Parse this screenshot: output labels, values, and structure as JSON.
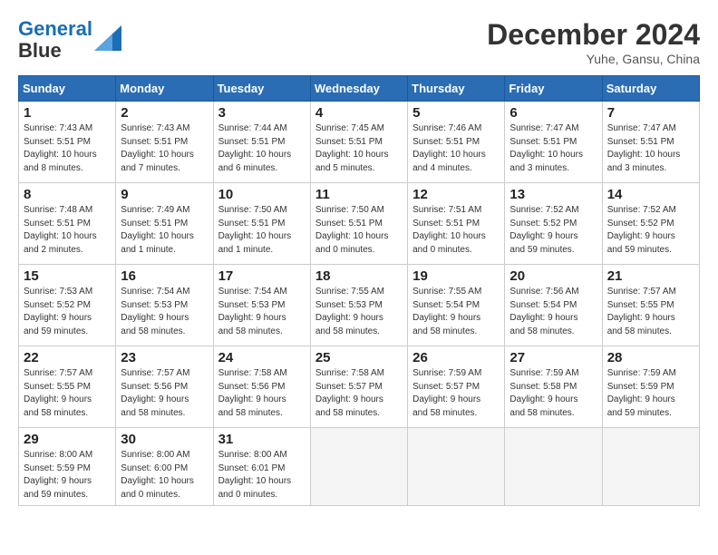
{
  "header": {
    "logo_line1": "General",
    "logo_line2": "Blue",
    "month": "December 2024",
    "location": "Yuhe, Gansu, China"
  },
  "days_of_week": [
    "Sunday",
    "Monday",
    "Tuesday",
    "Wednesday",
    "Thursday",
    "Friday",
    "Saturday"
  ],
  "weeks": [
    [
      {
        "day": 1,
        "info": "Sunrise: 7:43 AM\nSunset: 5:51 PM\nDaylight: 10 hours\nand 8 minutes."
      },
      {
        "day": 2,
        "info": "Sunrise: 7:43 AM\nSunset: 5:51 PM\nDaylight: 10 hours\nand 7 minutes."
      },
      {
        "day": 3,
        "info": "Sunrise: 7:44 AM\nSunset: 5:51 PM\nDaylight: 10 hours\nand 6 minutes."
      },
      {
        "day": 4,
        "info": "Sunrise: 7:45 AM\nSunset: 5:51 PM\nDaylight: 10 hours\nand 5 minutes."
      },
      {
        "day": 5,
        "info": "Sunrise: 7:46 AM\nSunset: 5:51 PM\nDaylight: 10 hours\nand 4 minutes."
      },
      {
        "day": 6,
        "info": "Sunrise: 7:47 AM\nSunset: 5:51 PM\nDaylight: 10 hours\nand 3 minutes."
      },
      {
        "day": 7,
        "info": "Sunrise: 7:47 AM\nSunset: 5:51 PM\nDaylight: 10 hours\nand 3 minutes."
      }
    ],
    [
      {
        "day": 8,
        "info": "Sunrise: 7:48 AM\nSunset: 5:51 PM\nDaylight: 10 hours\nand 2 minutes."
      },
      {
        "day": 9,
        "info": "Sunrise: 7:49 AM\nSunset: 5:51 PM\nDaylight: 10 hours\nand 1 minute."
      },
      {
        "day": 10,
        "info": "Sunrise: 7:50 AM\nSunset: 5:51 PM\nDaylight: 10 hours\nand 1 minute."
      },
      {
        "day": 11,
        "info": "Sunrise: 7:50 AM\nSunset: 5:51 PM\nDaylight: 10 hours\nand 0 minutes."
      },
      {
        "day": 12,
        "info": "Sunrise: 7:51 AM\nSunset: 5:51 PM\nDaylight: 10 hours\nand 0 minutes."
      },
      {
        "day": 13,
        "info": "Sunrise: 7:52 AM\nSunset: 5:52 PM\nDaylight: 9 hours\nand 59 minutes."
      },
      {
        "day": 14,
        "info": "Sunrise: 7:52 AM\nSunset: 5:52 PM\nDaylight: 9 hours\nand 59 minutes."
      }
    ],
    [
      {
        "day": 15,
        "info": "Sunrise: 7:53 AM\nSunset: 5:52 PM\nDaylight: 9 hours\nand 59 minutes."
      },
      {
        "day": 16,
        "info": "Sunrise: 7:54 AM\nSunset: 5:53 PM\nDaylight: 9 hours\nand 58 minutes."
      },
      {
        "day": 17,
        "info": "Sunrise: 7:54 AM\nSunset: 5:53 PM\nDaylight: 9 hours\nand 58 minutes."
      },
      {
        "day": 18,
        "info": "Sunrise: 7:55 AM\nSunset: 5:53 PM\nDaylight: 9 hours\nand 58 minutes."
      },
      {
        "day": 19,
        "info": "Sunrise: 7:55 AM\nSunset: 5:54 PM\nDaylight: 9 hours\nand 58 minutes."
      },
      {
        "day": 20,
        "info": "Sunrise: 7:56 AM\nSunset: 5:54 PM\nDaylight: 9 hours\nand 58 minutes."
      },
      {
        "day": 21,
        "info": "Sunrise: 7:57 AM\nSunset: 5:55 PM\nDaylight: 9 hours\nand 58 minutes."
      }
    ],
    [
      {
        "day": 22,
        "info": "Sunrise: 7:57 AM\nSunset: 5:55 PM\nDaylight: 9 hours\nand 58 minutes."
      },
      {
        "day": 23,
        "info": "Sunrise: 7:57 AM\nSunset: 5:56 PM\nDaylight: 9 hours\nand 58 minutes."
      },
      {
        "day": 24,
        "info": "Sunrise: 7:58 AM\nSunset: 5:56 PM\nDaylight: 9 hours\nand 58 minutes."
      },
      {
        "day": 25,
        "info": "Sunrise: 7:58 AM\nSunset: 5:57 PM\nDaylight: 9 hours\nand 58 minutes."
      },
      {
        "day": 26,
        "info": "Sunrise: 7:59 AM\nSunset: 5:57 PM\nDaylight: 9 hours\nand 58 minutes."
      },
      {
        "day": 27,
        "info": "Sunrise: 7:59 AM\nSunset: 5:58 PM\nDaylight: 9 hours\nand 58 minutes."
      },
      {
        "day": 28,
        "info": "Sunrise: 7:59 AM\nSunset: 5:59 PM\nDaylight: 9 hours\nand 59 minutes."
      }
    ],
    [
      {
        "day": 29,
        "info": "Sunrise: 8:00 AM\nSunset: 5:59 PM\nDaylight: 9 hours\nand 59 minutes."
      },
      {
        "day": 30,
        "info": "Sunrise: 8:00 AM\nSunset: 6:00 PM\nDaylight: 10 hours\nand 0 minutes."
      },
      {
        "day": 31,
        "info": "Sunrise: 8:00 AM\nSunset: 6:01 PM\nDaylight: 10 hours\nand 0 minutes."
      },
      null,
      null,
      null,
      null
    ]
  ]
}
